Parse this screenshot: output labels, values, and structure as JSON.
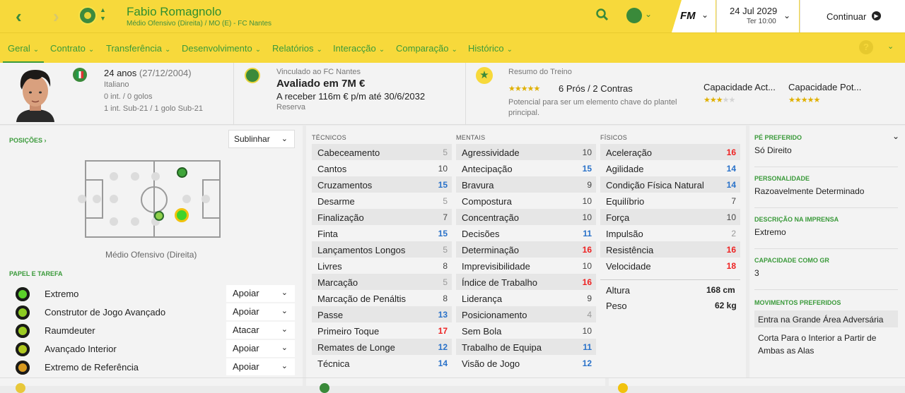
{
  "header": {
    "player_name": "Fabio Romagnolo",
    "subtitle": "Médio Ofensivo (Direita) / MO (E) - FC Nantes",
    "date": "24 Jul 2029",
    "time": "Ter 10:00",
    "fm_logo": "FM",
    "continue_label": "Continuar",
    "back_icon": "chevron-left-icon",
    "forward_icon": "chevron-right-icon"
  },
  "tabs": [
    "Geral",
    "Contrato",
    "Transferência",
    "Desenvolvimento",
    "Relatórios",
    "Interacção",
    "Comparação",
    "Histórico"
  ],
  "info": {
    "age": "24 anos",
    "birth": "(27/12/2004)",
    "nationality": "Italiano",
    "caps": "0 int. / 0 golos",
    "youth_caps": "1 int. Sub-21 / 1 golo Sub-21",
    "club_label": "Vinculado ao FC Nantes",
    "value": "Avaliado em 7M €",
    "wage": "A receber 116m € p/m até 30/6/2032",
    "squad_status": "Reserva",
    "training_title": "Resumo do Treino",
    "training_stars": 4.5,
    "pros_cons": "6 Prós / 2 Contras",
    "training_desc": "Potencial para ser um elemento chave do plantel principal.",
    "current_ability_label": "Capacidade Act...",
    "current_ability_stars": 2.5,
    "potential_ability_label": "Capacidade Pot...",
    "potential_ability_stars": 4.5
  },
  "positions": {
    "title": "POSIÇÕES",
    "highlight": "Sublinhar",
    "position_label": "Médio Ofensivo (Direita)"
  },
  "roles": {
    "title": "PAPEL E TAREFA",
    "items": [
      {
        "name": "Extremo",
        "duty": "Apoiar",
        "color": "#5bd12a"
      },
      {
        "name": "Construtor de Jogo Avançado",
        "duty": "Apoiar",
        "color": "#8ccc22"
      },
      {
        "name": "Raumdeuter",
        "duty": "Atacar",
        "color": "#9ccc22"
      },
      {
        "name": "Avançado Interior",
        "duty": "Apoiar",
        "color": "#b0c820"
      },
      {
        "name": "Extremo de Referência",
        "duty": "Apoiar",
        "color": "#d89a20"
      }
    ]
  },
  "technical": {
    "title": "TÉCNICOS",
    "items": [
      {
        "name": "Cabeceamento",
        "value": "5",
        "cls": "c-g"
      },
      {
        "name": "Cantos",
        "value": "10",
        "cls": "c-n"
      },
      {
        "name": "Cruzamentos",
        "value": "15",
        "cls": "c-b"
      },
      {
        "name": "Desarme",
        "value": "5",
        "cls": "c-g"
      },
      {
        "name": "Finalização",
        "value": "7",
        "cls": "c-n"
      },
      {
        "name": "Finta",
        "value": "15",
        "cls": "c-b"
      },
      {
        "name": "Lançamentos Longos",
        "value": "5",
        "cls": "c-g"
      },
      {
        "name": "Livres",
        "value": "8",
        "cls": "c-n"
      },
      {
        "name": "Marcação",
        "value": "5",
        "cls": "c-g"
      },
      {
        "name": "Marcação de Penáltis",
        "value": "8",
        "cls": "c-n"
      },
      {
        "name": "Passe",
        "value": "13",
        "cls": "c-b"
      },
      {
        "name": "Primeiro Toque",
        "value": "17",
        "cls": "c-r"
      },
      {
        "name": "Remates de Longe",
        "value": "12",
        "cls": "c-b"
      },
      {
        "name": "Técnica",
        "value": "14",
        "cls": "c-b"
      }
    ]
  },
  "mental": {
    "title": "MENTAIS",
    "items": [
      {
        "name": "Agressividade",
        "value": "10",
        "cls": "c-n"
      },
      {
        "name": "Antecipação",
        "value": "15",
        "cls": "c-b"
      },
      {
        "name": "Bravura",
        "value": "9",
        "cls": "c-n"
      },
      {
        "name": "Compostura",
        "value": "10",
        "cls": "c-n"
      },
      {
        "name": "Concentração",
        "value": "10",
        "cls": "c-n"
      },
      {
        "name": "Decisões",
        "value": "11",
        "cls": "c-b"
      },
      {
        "name": "Determinação",
        "value": "16",
        "cls": "c-r"
      },
      {
        "name": "Imprevisibilidade",
        "value": "10",
        "cls": "c-n"
      },
      {
        "name": "Índice de Trabalho",
        "value": "16",
        "cls": "c-r"
      },
      {
        "name": "Liderança",
        "value": "9",
        "cls": "c-n"
      },
      {
        "name": "Posicionamento",
        "value": "4",
        "cls": "c-g"
      },
      {
        "name": "Sem Bola",
        "value": "10",
        "cls": "c-n"
      },
      {
        "name": "Trabalho de Equipa",
        "value": "11",
        "cls": "c-b"
      },
      {
        "name": "Visão de Jogo",
        "value": "12",
        "cls": "c-b"
      }
    ]
  },
  "physical": {
    "title": "FÍSICOS",
    "items": [
      {
        "name": "Aceleração",
        "value": "16",
        "cls": "c-r"
      },
      {
        "name": "Agilidade",
        "value": "14",
        "cls": "c-b"
      },
      {
        "name": "Condição Física Natural",
        "value": "14",
        "cls": "c-b"
      },
      {
        "name": "Equilíbrio",
        "value": "7",
        "cls": "c-n"
      },
      {
        "name": "Força",
        "value": "10",
        "cls": "c-n"
      },
      {
        "name": "Impulsão",
        "value": "2",
        "cls": "c-g"
      },
      {
        "name": "Resistência",
        "value": "16",
        "cls": "c-r"
      },
      {
        "name": "Velocidade",
        "value": "18",
        "cls": "c-r"
      }
    ],
    "height_label": "Altura",
    "height": "168 cm",
    "weight_label": "Peso",
    "weight": "62 kg"
  },
  "side": {
    "foot_label": "PÉ PREFERIDO",
    "foot": "Só Direito",
    "personality_label": "PERSONALIDADE",
    "personality": "Razoavelmente Determinado",
    "press_label": "DESCRIÇÃO NA IMPRENSA",
    "press": "Extremo",
    "gk_label": "CAPACIDADE COMO GR",
    "gk": "3",
    "moves_label": "MOVIMENTOS PREFERIDOS",
    "moves": [
      "Entra na Grande Área Adversária",
      "Corta Para o Interior a Partir de Ambas as Alas"
    ]
  }
}
